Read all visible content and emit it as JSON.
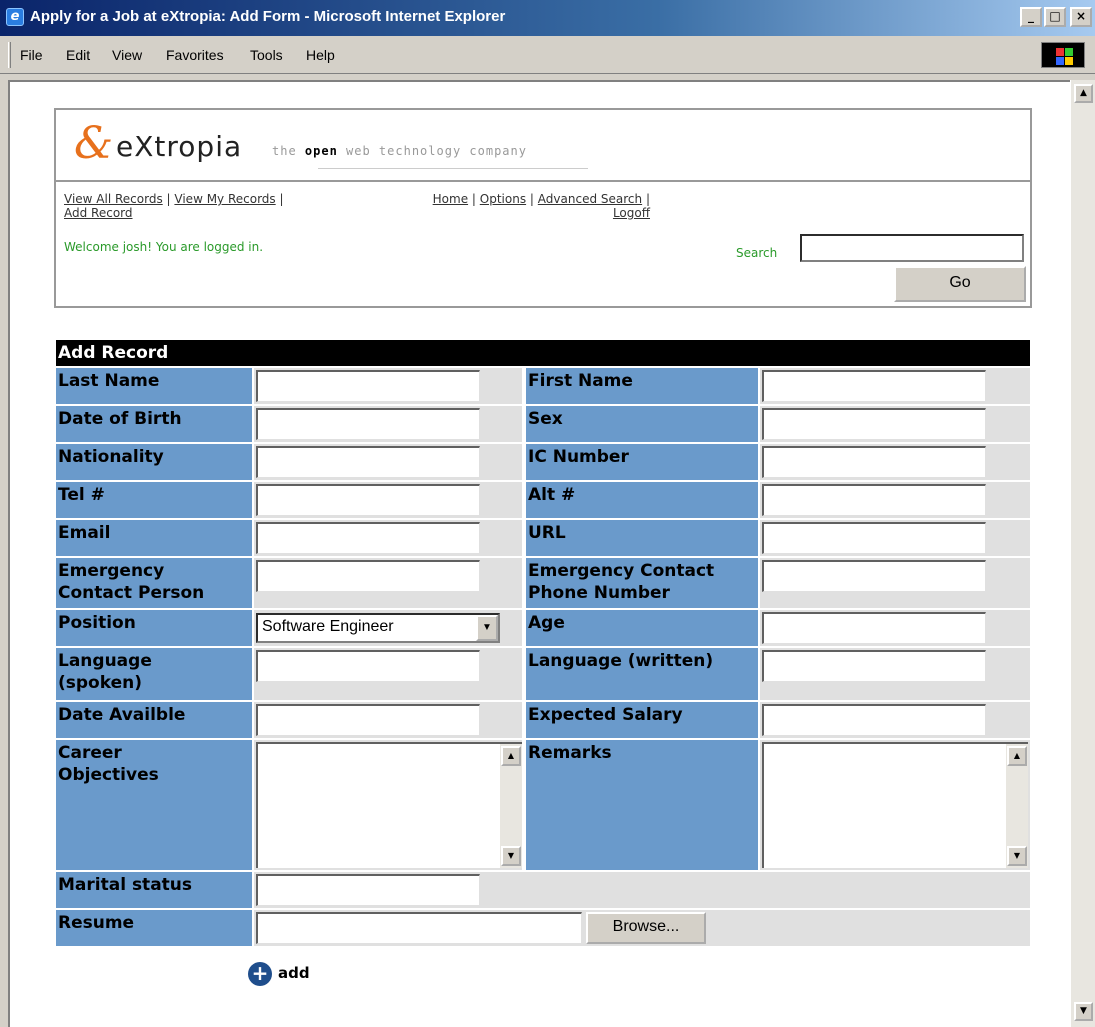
{
  "window": {
    "title": "Apply for a Job at eXtropia: Add Form - Microsoft Internet Explorer",
    "minimize": "_",
    "maximize": "□",
    "close": "×"
  },
  "menu": [
    "File",
    "Edit",
    "View",
    "Favorites",
    "Tools",
    "Help"
  ],
  "header": {
    "logo_word": "eXtropia",
    "tagline_pre": "the ",
    "tagline_bold": "open",
    "tagline_post": " web technology company",
    "links_left": [
      "View All Records",
      "View My Records",
      "Add Record"
    ],
    "links_right": [
      "Home",
      "Options",
      "Advanced Search",
      "Logoff"
    ],
    "separator": "|",
    "welcome": "Welcome josh! You are logged in.",
    "search_label": "Search",
    "search_value": "",
    "go_label": "Go"
  },
  "form": {
    "title": "Add Record",
    "fields": {
      "last_name": "Last Name",
      "first_name": "First Name",
      "dob": "Date of Birth",
      "sex": "Sex",
      "nationality": "Nationality",
      "ic_number": "IC Number",
      "tel": "Tel #",
      "alt": "Alt #",
      "email": "Email",
      "url": "URL",
      "emergency_person_1": "Emergency",
      "emergency_person_2": "Contact Person",
      "emergency_phone_1": "Emergency Contact",
      "emergency_phone_2": "Phone Number",
      "position": "Position",
      "age": "Age",
      "lang_spoken_1": "Language",
      "lang_spoken_2": "(spoken)",
      "lang_written": "Language (written)",
      "date_avail": "Date Availble",
      "expected_salary": "Expected Salary",
      "career_1": "Career",
      "career_2": "Objectives",
      "remarks": "Remarks",
      "marital": "Marital status",
      "resume": "Resume"
    },
    "position_selected": "Software Engineer",
    "browse_label": "Browse...",
    "add_label": "add"
  }
}
